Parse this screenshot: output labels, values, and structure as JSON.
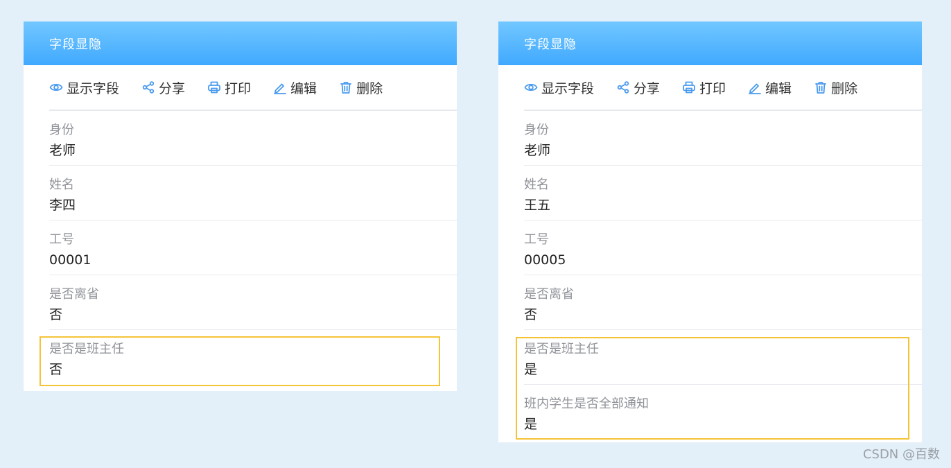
{
  "left_panel": {
    "title": "字段显隐",
    "toolbar": {
      "show_fields": "显示字段",
      "share": "分享",
      "print": "打印",
      "edit": "编辑",
      "delete": "删除"
    },
    "fields": [
      {
        "label": "身份",
        "value": "老师"
      },
      {
        "label": "姓名",
        "value": "李四"
      },
      {
        "label": "工号",
        "value": "00001"
      },
      {
        "label": "是否离省",
        "value": "否"
      },
      {
        "label": "是否是班主任",
        "value": "否"
      }
    ]
  },
  "right_panel": {
    "title": "字段显隐",
    "toolbar": {
      "show_fields": "显示字段",
      "share": "分享",
      "print": "打印",
      "edit": "编辑",
      "delete": "删除"
    },
    "fields": [
      {
        "label": "身份",
        "value": "老师"
      },
      {
        "label": "姓名",
        "value": "王五"
      },
      {
        "label": "工号",
        "value": "00005"
      },
      {
        "label": "是否离省",
        "value": "否"
      },
      {
        "label": "是否是班主任",
        "value": "是"
      },
      {
        "label": "班内学生是否全部通知",
        "value": "是"
      }
    ]
  },
  "watermark": "CSDN @百数",
  "colors": {
    "header_top": "#72c7ff",
    "header_bottom": "#40a9ff",
    "icon": "#4a9bef",
    "highlight_border": "#f5c436",
    "background": "#e3f0fa"
  },
  "icons": [
    "eye-icon",
    "share-icon",
    "printer-icon",
    "edit-icon",
    "trash-icon"
  ]
}
